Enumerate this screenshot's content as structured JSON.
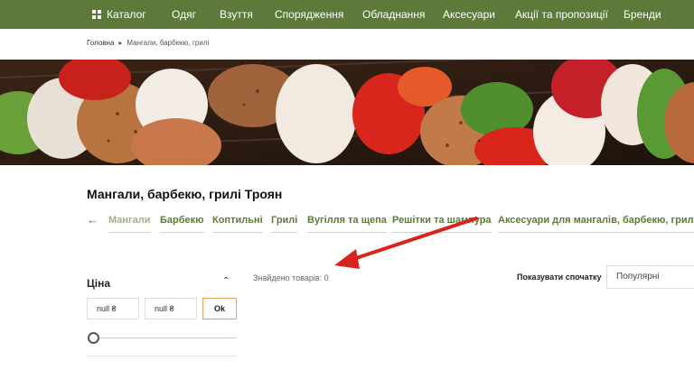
{
  "nav": {
    "catalog_label": "Каталог",
    "items": [
      "Одяг",
      "Взуття",
      "Спорядження",
      "Обладнання",
      "Аксесуари",
      "Акції та пропозиції",
      "Бренди"
    ],
    "bg_color": "#5d7a3a"
  },
  "breadcrumb": {
    "home": "Головна",
    "current": "Мангали, барбекю, грилі"
  },
  "banner": {
    "icon": "grilled-skewers-photo"
  },
  "page_title": "Мангали, барбекю, грилі Троян",
  "categories": [
    "Мангали",
    "Барбекю",
    "Коптильні",
    "Грилі",
    "Вугілля та щепа",
    "Решітки та шампура",
    "Аксесуари для мангалів, барбекю, грилів"
  ],
  "results": {
    "found_text": "Знайдено товарів: 0",
    "sort_label": "Показувати спочатку",
    "sort_value": "Популярні"
  },
  "filter": {
    "title": "Ціна",
    "min_value": "null ₴",
    "max_value": "null ₴",
    "ok_label": "Ok",
    "accent_color": "#e6a15a"
  }
}
